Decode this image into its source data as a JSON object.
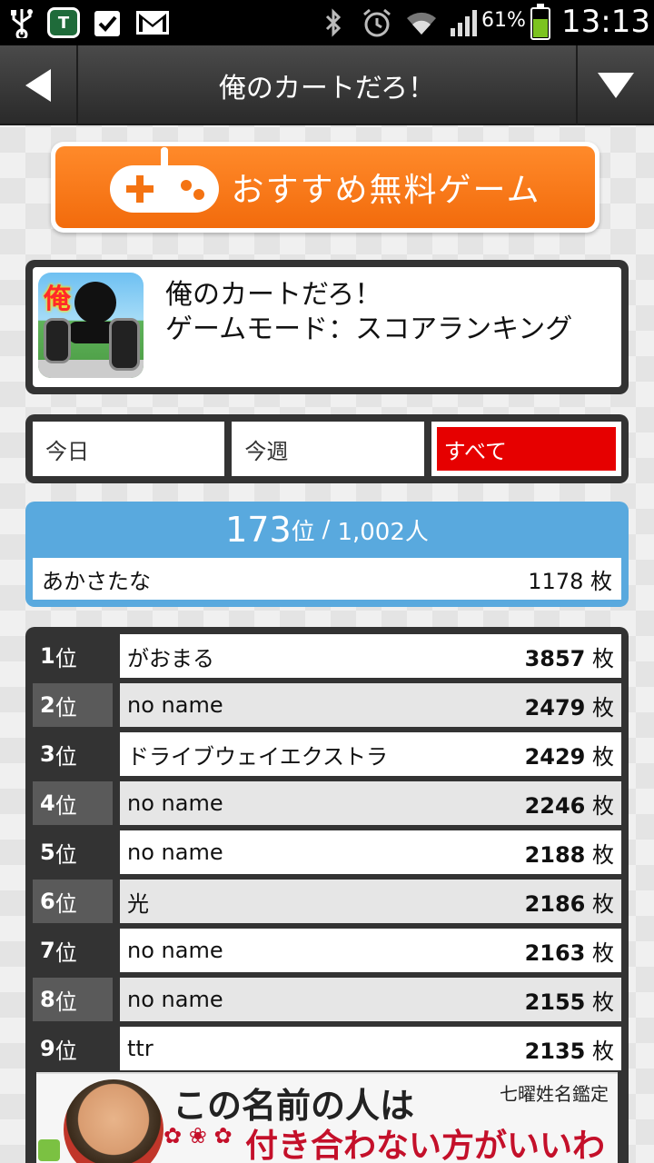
{
  "statusbar": {
    "battery_percent": "61%",
    "battery_level": 0.61,
    "time": "13:13",
    "icons": [
      "usb-icon",
      "shield-app-icon",
      "clipboard-check-icon",
      "gmail-icon",
      "bluetooth-icon",
      "alarm-icon",
      "wifi-icon",
      "signal-icon",
      "battery-charging-icon"
    ]
  },
  "navbar": {
    "title": "俺のカートだろ！",
    "back_icon": "back-arrow-icon",
    "menu_icon": "dropdown-triangle-icon"
  },
  "promo": {
    "label": "おすすめ無料ゲーム",
    "icon": "gamepad-icon",
    "color": "#f26b0c"
  },
  "game": {
    "name": "俺のカートだろ！",
    "mode": "ゲームモード：スコアランキング",
    "icon_kanji": "俺"
  },
  "tabs": [
    {
      "label": "今日",
      "active": false
    },
    {
      "label": "今週",
      "active": false
    },
    {
      "label": "すべて",
      "active": true
    }
  ],
  "my_rank": {
    "position": "173",
    "rank_unit": "位",
    "separator": "/",
    "total": "1,002人",
    "name": "あかさたな",
    "score": "1178 枚",
    "color": "#59a9de"
  },
  "ranking": [
    {
      "rank": "1",
      "unit": "位",
      "name": "がおまる",
      "score": "3857",
      "score_unit": "枚"
    },
    {
      "rank": "2",
      "unit": "位",
      "name": "no name",
      "score": "2479",
      "score_unit": "枚"
    },
    {
      "rank": "3",
      "unit": "位",
      "name": "ドライブウェイエクストラ",
      "score": "2429",
      "score_unit": "枚"
    },
    {
      "rank": "4",
      "unit": "位",
      "name": "no name",
      "score": "2246",
      "score_unit": "枚"
    },
    {
      "rank": "5",
      "unit": "位",
      "name": "no name",
      "score": "2188",
      "score_unit": "枚"
    },
    {
      "rank": "6",
      "unit": "位",
      "name": "光",
      "score": "2186",
      "score_unit": "枚"
    },
    {
      "rank": "7",
      "unit": "位",
      "name": "no name",
      "score": "2163",
      "score_unit": "枚"
    },
    {
      "rank": "8",
      "unit": "位",
      "name": "no name",
      "score": "2155",
      "score_unit": "枚"
    },
    {
      "rank": "9",
      "unit": "位",
      "name": "ttr",
      "score": "2135",
      "score_unit": "枚"
    }
  ],
  "ad": {
    "line1": "この名前の人は",
    "brand": "七曜姓名鑑定",
    "line2": "付き合わない方がいいわ"
  },
  "colors": {
    "active_tab": "#e60000",
    "dark_frame": "#333333",
    "status_bar": "#000000"
  }
}
